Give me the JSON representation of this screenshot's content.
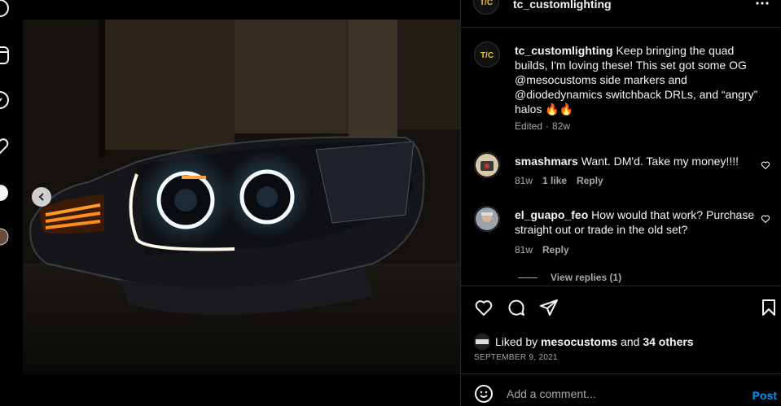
{
  "post": {
    "username": "tc_customlighting",
    "avatar_text": "T/C"
  },
  "caption": {
    "username": "tc_customlighting",
    "text": " Keep bringing the quad builds, I'm loving these! This set got some OG ",
    "mention1": "@mesocustoms",
    "text2": " side markers and ",
    "mention2": "@diodedynamics",
    "text3": " switchback DRLs, and “angry” halos 🔥🔥",
    "edited": "Edited",
    "time": "82w"
  },
  "comments": [
    {
      "username": "smashmars",
      "text": " Want. DM'd. Take my money!!!!",
      "time": "81w",
      "likes": "1 like",
      "reply": "Reply"
    },
    {
      "username": "el_guapo_feo",
      "text": " How would that work? Purchase straight out or trade in the old set?",
      "time": "81w",
      "reply": "Reply"
    }
  ],
  "view_replies": "View replies (1)",
  "likes": {
    "prefix": "Liked by ",
    "user": "mesocustoms",
    "middle": " and ",
    "others": "34 others"
  },
  "date": "SEPTEMBER 9, 2021",
  "add_comment": {
    "placeholder": "Add a comment...",
    "post_label": "Post"
  },
  "colors": {
    "accent": "#0095f6",
    "secondary_text": "#a8a8a8",
    "divider": "#262626"
  },
  "icons": {
    "rail": [
      "circle-icon",
      "reels-icon",
      "explore-icon",
      "heart-icon",
      "create-icon",
      "profile-icon"
    ],
    "actions": [
      "heart-icon",
      "comment-icon",
      "share-icon",
      "bookmark-icon"
    ]
  }
}
